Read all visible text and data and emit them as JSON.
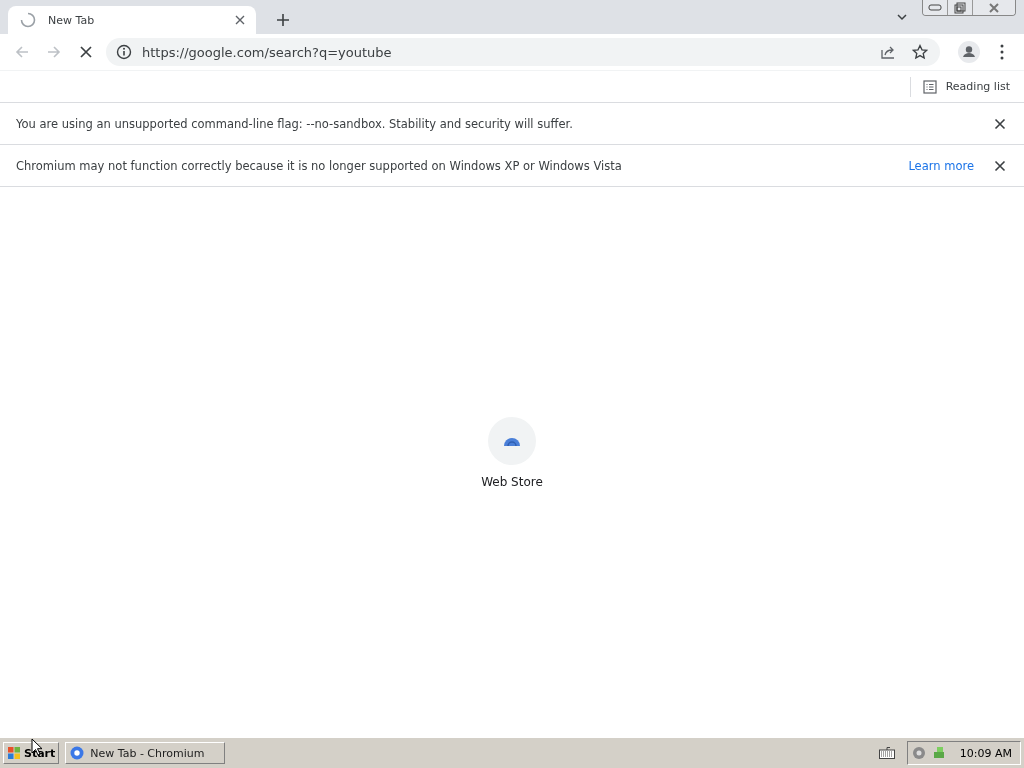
{
  "tabs": [
    {
      "title": "New Tab",
      "selected": true,
      "loading": true
    }
  ],
  "toolbar": {
    "url": "https://google.com/search?q=youtube",
    "loading": true
  },
  "bookmarks_bar": {
    "reading_list": "Reading list"
  },
  "infobars": [
    {
      "message": "You are using an unsupported command-line flag: --no-sandbox. Stability and security will suffer."
    },
    {
      "message": "Chromium may not function correctly because it is no longer supported on Windows XP or Windows Vista",
      "link": "Learn more"
    }
  ],
  "shortcuts": [
    {
      "title": "Web Store"
    }
  ],
  "taskbar": {
    "start": "Start",
    "tasks": [
      {
        "title": "New Tab - Chromium",
        "selected": false
      }
    ],
    "clock": "10:09 AM"
  }
}
